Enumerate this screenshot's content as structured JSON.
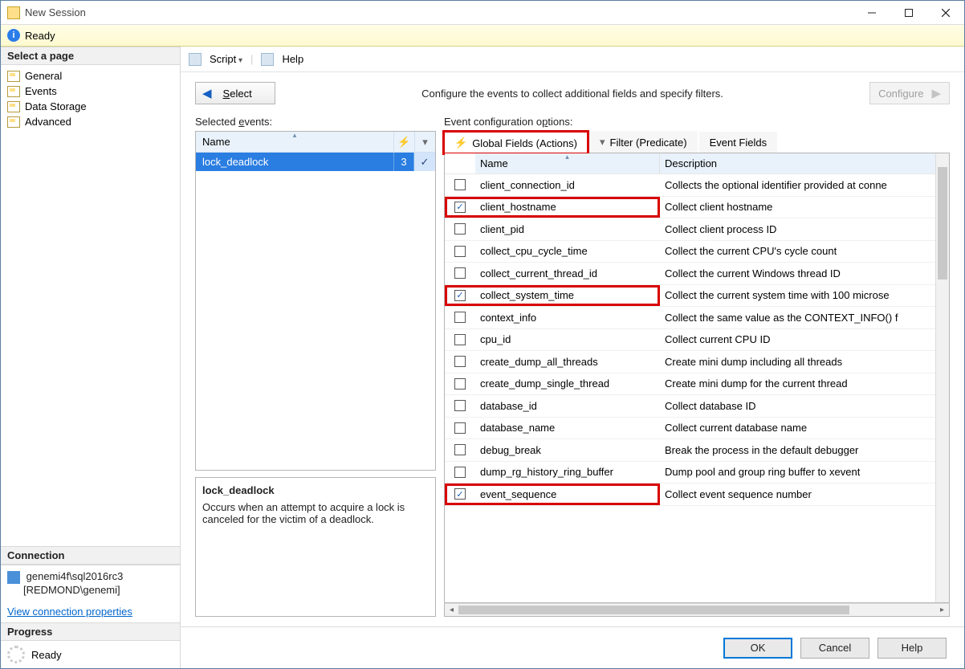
{
  "window": {
    "title": "New Session"
  },
  "status": {
    "text": "Ready"
  },
  "sidebar": {
    "header": "Select a page",
    "pages": [
      {
        "label": "General"
      },
      {
        "label": "Events"
      },
      {
        "label": "Data Storage"
      },
      {
        "label": "Advanced"
      }
    ],
    "connection_header": "Connection",
    "connection_line1": "genemi4f\\sql2016rc3",
    "connection_line2": "[REDMOND\\genemi]",
    "connection_link": "View connection properties",
    "progress_header": "Progress",
    "progress_text": "Ready"
  },
  "toolbar": {
    "script": "Script",
    "help": "Help"
  },
  "controls": {
    "select": "Select",
    "instruction": "Configure the events to collect additional fields and specify filters.",
    "configure": "Configure"
  },
  "selected_events": {
    "label": "Selected events:",
    "col_name": "Name",
    "rows": [
      {
        "name": "lock_deadlock",
        "count": "3",
        "checked": true
      }
    ]
  },
  "description": {
    "title": "lock_deadlock",
    "body": "Occurs when an attempt to acquire a lock is canceled for the victim of a deadlock."
  },
  "config_options": {
    "label": "Event configuration options:",
    "tabs": {
      "global": "Global Fields (Actions)",
      "filter": "Filter (Predicate)",
      "event_fields": "Event Fields"
    },
    "col_name": "Name",
    "col_desc": "Description",
    "rows": [
      {
        "checked": false,
        "name": "client_connection_id",
        "desc": "Collects the optional identifier provided at conne",
        "red": false
      },
      {
        "checked": true,
        "name": "client_hostname",
        "desc": "Collect client hostname",
        "red": true
      },
      {
        "checked": false,
        "name": "client_pid",
        "desc": "Collect client process ID",
        "red": false
      },
      {
        "checked": false,
        "name": "collect_cpu_cycle_time",
        "desc": "Collect the current CPU's cycle count",
        "red": false
      },
      {
        "checked": false,
        "name": "collect_current_thread_id",
        "desc": "Collect the current Windows thread ID",
        "red": false
      },
      {
        "checked": true,
        "name": "collect_system_time",
        "desc": "Collect the current system time with 100 microse",
        "red": true
      },
      {
        "checked": false,
        "name": "context_info",
        "desc": "Collect the same value as the CONTEXT_INFO() f",
        "red": false
      },
      {
        "checked": false,
        "name": "cpu_id",
        "desc": "Collect current CPU ID",
        "red": false
      },
      {
        "checked": false,
        "name": "create_dump_all_threads",
        "desc": "Create mini dump including all threads",
        "red": false
      },
      {
        "checked": false,
        "name": "create_dump_single_thread",
        "desc": "Create mini dump for the current thread",
        "red": false
      },
      {
        "checked": false,
        "name": "database_id",
        "desc": "Collect database ID",
        "red": false
      },
      {
        "checked": false,
        "name": "database_name",
        "desc": "Collect current database name",
        "red": false
      },
      {
        "checked": false,
        "name": "debug_break",
        "desc": "Break the process in the default debugger",
        "red": false
      },
      {
        "checked": false,
        "name": "dump_rg_history_ring_buffer",
        "desc": "Dump pool and group ring buffer to xevent",
        "red": false
      },
      {
        "checked": true,
        "name": "event_sequence",
        "desc": "Collect event sequence number",
        "red": true
      }
    ]
  },
  "footer": {
    "ok": "OK",
    "cancel": "Cancel",
    "help": "Help"
  }
}
